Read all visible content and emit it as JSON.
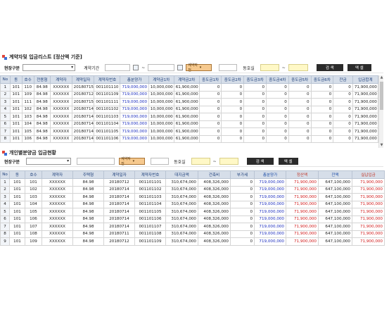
{
  "section1": {
    "title": "계약자및 입금리스트 [정산액 기준]",
    "filters": {
      "site_label": "현장구분",
      "period_label": "계약기간",
      "period_sep": "~",
      "contract_state": "계약자전",
      "dong_label": "동호실",
      "range_sep": "~",
      "search_button": "검 색",
      "excel_button": "엑 셀"
    },
    "columns": [
      "No",
      "동",
      "호수",
      "전용형",
      "계약자",
      "계약일자",
      "계약자번호",
      "총분양가",
      "계약금1차",
      "계약금2차",
      "중도금1차",
      "중도금2차",
      "중도금3차",
      "중도금4차",
      "중도금5차",
      "중도금6차",
      "잔금",
      "입금합계"
    ],
    "rows": [
      [
        "1",
        "101",
        "110",
        "84.98",
        "XXXXXX",
        "20180715",
        "001101110",
        "719,000,000",
        "10,000,000",
        "61,900,000",
        "0",
        "0",
        "0",
        "0",
        "0",
        "0",
        "0",
        "71,900,000"
      ],
      [
        "2",
        "101",
        "109",
        "84.98",
        "XXXXXX",
        "20180712",
        "001101109",
        "719,000,000",
        "10,000,000",
        "61,900,000",
        "0",
        "0",
        "0",
        "0",
        "0",
        "0",
        "0",
        "71,900,000"
      ],
      [
        "3",
        "101",
        "111",
        "84.98",
        "XXXXXX",
        "20180715",
        "001101111",
        "719,000,000",
        "10,000,000",
        "61,900,000",
        "0",
        "0",
        "0",
        "0",
        "0",
        "0",
        "0",
        "71,900,000"
      ],
      [
        "4",
        "101",
        "102",
        "84.98",
        "XXXXXX",
        "20180714",
        "001101102",
        "719,000,000",
        "10,000,000",
        "61,900,000",
        "0",
        "0",
        "0",
        "0",
        "0",
        "0",
        "0",
        "71,900,000"
      ],
      [
        "5",
        "101",
        "103",
        "84.98",
        "XXXXXX",
        "20180714",
        "001101103",
        "719,000,000",
        "10,000,000",
        "61,900,000",
        "0",
        "0",
        "0",
        "0",
        "0",
        "0",
        "0",
        "71,900,000"
      ],
      [
        "6",
        "101",
        "104",
        "84.98",
        "XXXXXX",
        "20180714",
        "001101104",
        "719,000,000",
        "10,000,000",
        "61,900,000",
        "0",
        "0",
        "0",
        "0",
        "0",
        "0",
        "0",
        "71,900,000"
      ],
      [
        "7",
        "101",
        "105",
        "84.98",
        "XXXXXX",
        "20180714",
        "001101105",
        "719,000,000",
        "10,000,000",
        "61,900,000",
        "0",
        "0",
        "0",
        "0",
        "0",
        "0",
        "0",
        "71,900,000"
      ],
      [
        "8",
        "101",
        "106",
        "84.98",
        "XXXXXX",
        "20180714",
        "001101106",
        "719,000,000",
        "10,000,000",
        "61,900,000",
        "0",
        "0",
        "0",
        "0",
        "0",
        "0",
        "0",
        "71,900,000"
      ]
    ]
  },
  "section2": {
    "title": "개인별분양금 입금현황",
    "filters": {
      "site_label": "현장구분",
      "contract_state": "계약자전",
      "dong_label": "동호실",
      "range_sep": "~",
      "search_button": "검 색",
      "excel_button": "엑 셀"
    },
    "columns": [
      "No",
      "동",
      "호수",
      "계약자",
      "주택형",
      "계약일자",
      "계약자번호",
      "대지금액",
      "건축비",
      "부가세",
      "총분양가",
      "정산액",
      "잔액",
      "실납입금"
    ],
    "rows": [
      [
        "1",
        "101",
        "101",
        "XXXXXX",
        "84.98",
        "20180712",
        "001101101",
        "310,674,000",
        "408,326,000",
        "0",
        "719,000,000",
        "71,900,000",
        "647,100,000",
        "71,900,000"
      ],
      [
        "2",
        "101",
        "102",
        "XXXXXX",
        "84.98",
        "20180714",
        "001101102",
        "310,674,000",
        "408,326,000",
        "0",
        "719,000,000",
        "71,900,000",
        "647,100,000",
        "71,900,000"
      ],
      [
        "3",
        "101",
        "103",
        "XXXXXX",
        "84.98",
        "20180714",
        "001101103",
        "310,674,000",
        "408,326,000",
        "0",
        "719,000,000",
        "71,900,000",
        "647,100,000",
        "71,900,000"
      ],
      [
        "4",
        "101",
        "104",
        "XXXXXX",
        "84.98",
        "20180714",
        "001101104",
        "310,674,000",
        "408,326,000",
        "0",
        "719,000,000",
        "71,900,000",
        "647,100,000",
        "71,900,000"
      ],
      [
        "5",
        "101",
        "105",
        "XXXXXX",
        "84.98",
        "20180714",
        "001101105",
        "310,674,000",
        "408,326,000",
        "0",
        "719,000,000",
        "71,900,000",
        "647,100,000",
        "71,900,000"
      ],
      [
        "6",
        "101",
        "106",
        "XXXXXX",
        "84.98",
        "20180714",
        "001101106",
        "310,674,000",
        "408,326,000",
        "0",
        "719,000,000",
        "71,900,000",
        "647,100,000",
        "71,900,000"
      ],
      [
        "7",
        "101",
        "107",
        "XXXXXX",
        "84.98",
        "20180714",
        "001101107",
        "310,674,000",
        "408,326,000",
        "0",
        "719,000,000",
        "71,900,000",
        "647,100,000",
        "71,900,000"
      ],
      [
        "8",
        "101",
        "108",
        "XXXXXX",
        "84.98",
        "20180711",
        "001101108",
        "310,674,000",
        "408,326,000",
        "0",
        "719,000,000",
        "71,900,000",
        "647,100,000",
        "71,900,000"
      ],
      [
        "9",
        "101",
        "109",
        "XXXXXX",
        "84.98",
        "20180712",
        "001101109",
        "310,674,000",
        "408,326,000",
        "0",
        "719,000,000",
        "71,900,000",
        "647,100,000",
        "71,900,000"
      ]
    ]
  }
}
